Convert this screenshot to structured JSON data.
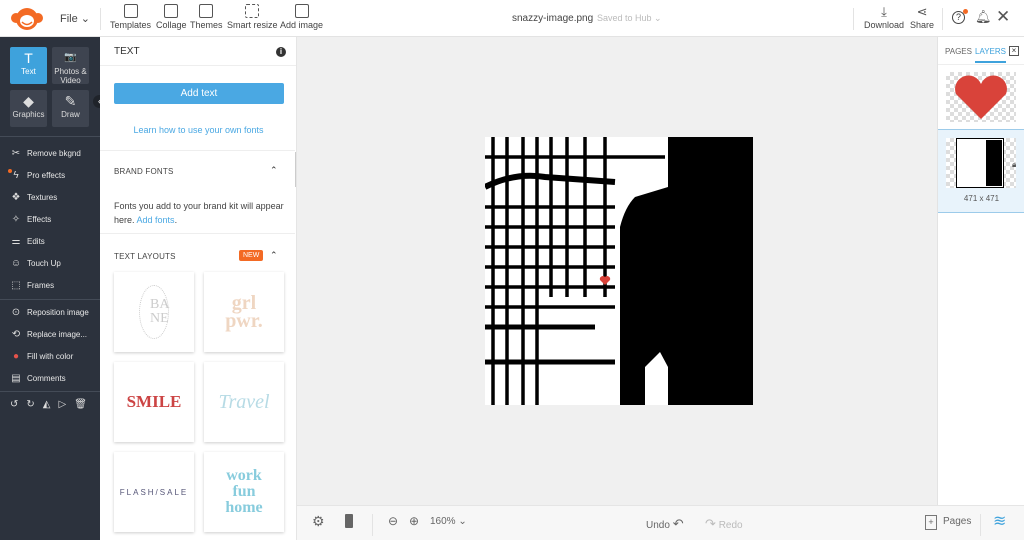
{
  "topbar": {
    "file_label": "File",
    "tools": [
      {
        "label": "Templates",
        "icon": "templates-icon"
      },
      {
        "label": "Collage",
        "icon": "collage-icon"
      },
      {
        "label": "Themes",
        "icon": "themes-icon"
      },
      {
        "label": "Smart resize",
        "icon": "smart-resize-icon"
      },
      {
        "label": "Add image",
        "icon": "add-image-icon"
      }
    ],
    "filename": "snazzy-image.png",
    "save_status": "Saved to Hub",
    "download": "Download",
    "share": "Share"
  },
  "sidebar": {
    "tiles": [
      {
        "label": "Text",
        "glyph": "T"
      },
      {
        "label": "Photos & Video",
        "glyph": "📷"
      },
      {
        "label": "Graphics",
        "glyph": "◆"
      },
      {
        "label": "Draw",
        "glyph": "✎"
      }
    ],
    "items": [
      {
        "label": "Remove bkgnd",
        "glyph": "✂"
      },
      {
        "label": "Pro effects",
        "glyph": "ϟ"
      },
      {
        "label": "Textures",
        "glyph": "❖"
      },
      {
        "label": "Effects",
        "glyph": "✧"
      },
      {
        "label": "Edits",
        "glyph": "⚌"
      },
      {
        "label": "Touch Up",
        "glyph": "☺"
      },
      {
        "label": "Frames",
        "glyph": "⬚"
      }
    ],
    "items2": [
      {
        "label": "Reposition image",
        "glyph": "⊙"
      },
      {
        "label": "Replace image...",
        "glyph": "⟲"
      },
      {
        "label": "Fill with color",
        "glyph": "●"
      },
      {
        "label": "Comments",
        "glyph": "▤"
      }
    ],
    "actions": [
      "↺",
      "↻",
      "◭",
      "▷",
      "🗑"
    ]
  },
  "panel": {
    "title": "TEXT",
    "add_text": "Add text",
    "learn_link": "Learn how to use your own fonts",
    "brand_fonts": "BRAND FONTS",
    "brand_text": "Fonts you add to your brand kit will appear here.",
    "add_fonts": "Add fonts",
    "text_layouts": "TEXT LAYOUTS",
    "new_badge": "NEW",
    "layouts": [
      "BA NE",
      "grl pwr.",
      "SMILE",
      "Travel",
      "FLASH/SALE",
      "work fun home"
    ]
  },
  "layers": {
    "tab_pages": "PAGES",
    "tab_layers": "LAYERS",
    "size": "471 x 471"
  },
  "bottom": {
    "zoom": "160%",
    "undo": "Undo",
    "redo": "Redo",
    "pages": "Pages"
  },
  "colors": {
    "accent": "#3ea2dc",
    "sidebar": "#2c323d",
    "badge": "#f36a24",
    "heart": "#d9433a"
  }
}
